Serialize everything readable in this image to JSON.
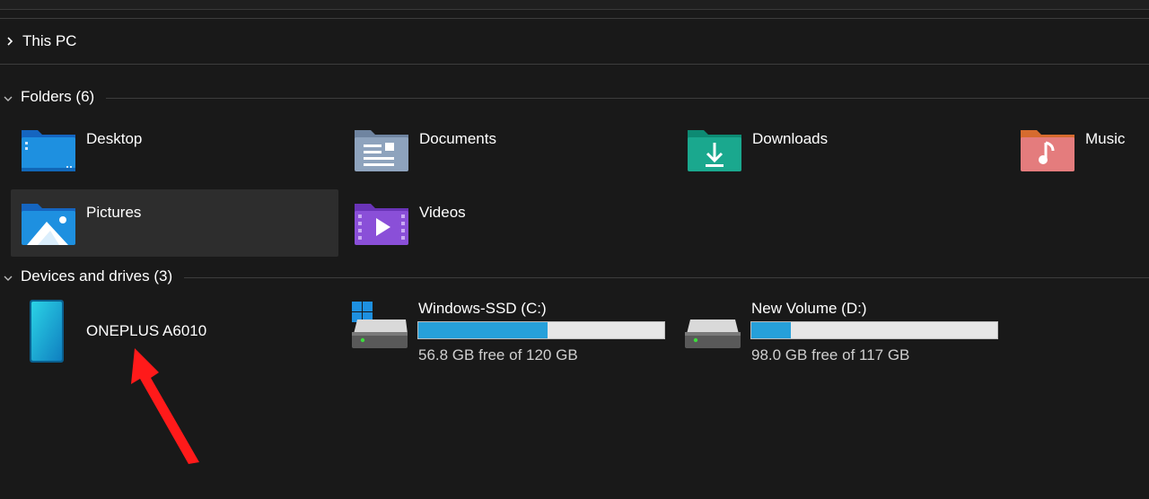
{
  "breadcrumb": {
    "label": "This PC"
  },
  "sections": {
    "folders": {
      "label": "Folders (6)"
    },
    "devices": {
      "label": "Devices and drives (3)"
    }
  },
  "folders": [
    {
      "name": "Desktop",
      "icon": "desktop-folder-icon",
      "color": "#1e90e0"
    },
    {
      "name": "Documents",
      "icon": "documents-folder-icon",
      "color": "#8aa0b8"
    },
    {
      "name": "Downloads",
      "icon": "downloads-folder-icon",
      "color": "#1aa88e"
    },
    {
      "name": "Music",
      "icon": "music-folder-icon",
      "color": "#e58a6e"
    },
    {
      "name": "Pictures",
      "icon": "pictures-folder-icon",
      "color": "#1e90e0",
      "selected": true
    },
    {
      "name": "Videos",
      "icon": "videos-folder-icon",
      "color": "#8a4fd8"
    }
  ],
  "devices": [
    {
      "name": "ONEPLUS A6010",
      "icon": "phone-icon"
    }
  ],
  "drives": [
    {
      "name": "Windows-SSD (C:)",
      "free_text": "56.8 GB free of 120 GB",
      "used_fraction": 0.527,
      "icon": "system-drive-icon"
    },
    {
      "name": "New Volume (D:)",
      "free_text": "98.0 GB free of 117 GB",
      "used_fraction": 0.162,
      "icon": "drive-icon"
    }
  ],
  "colors": {
    "background": "#191919",
    "selected": "#2d2d2d",
    "bar_fill": "#26a0da",
    "bar_track": "#e6e6e6",
    "annotation_arrow": "#ff1a1a"
  }
}
